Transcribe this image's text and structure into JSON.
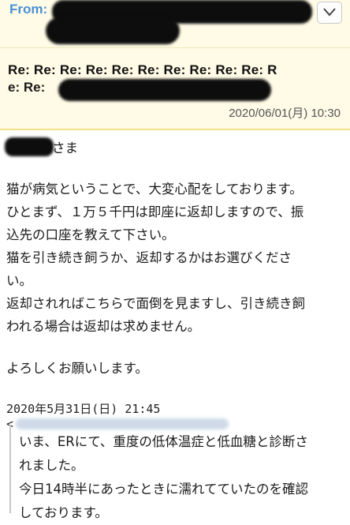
{
  "header": {
    "from_label": "From:",
    "subject_line1": "Re: Re: Re: Re: Re: Re: Re: Re: Re: Re: R",
    "subject_line2": "e: Re:",
    "date": "2020/06/01(月) 10:30"
  },
  "body": {
    "salutation_suffix": "さま",
    "lines": [
      "猫が病気ということで、大変心配をしております。",
      "ひとまず、１万５千円は即座に返却しますので、振",
      "込先の口座を教えて下さい。",
      "猫を引き続き飼うか、返却するかはお選びくださ",
      "い。",
      "返却されればこちらで面倒を見ますし、引き続き飼",
      "われる場合は返却は求めません。"
    ],
    "closing": "よろしくお願いします。"
  },
  "quote": {
    "date_line": "2020年5月31日(日) 21:45",
    "open_bracket": "<",
    "lines": [
      "いま、ERにて、重度の低体温症と低血糖と診断さ",
      "れました。",
      "今日14時半にあったときに濡れてていたのを確認",
      "しております。"
    ]
  },
  "icons": {
    "expand": "chevron-down-icon"
  },
  "colors": {
    "header_bg": "#fffbe6",
    "from_label": "#4a8fd6",
    "divider": "#f2e08a"
  }
}
